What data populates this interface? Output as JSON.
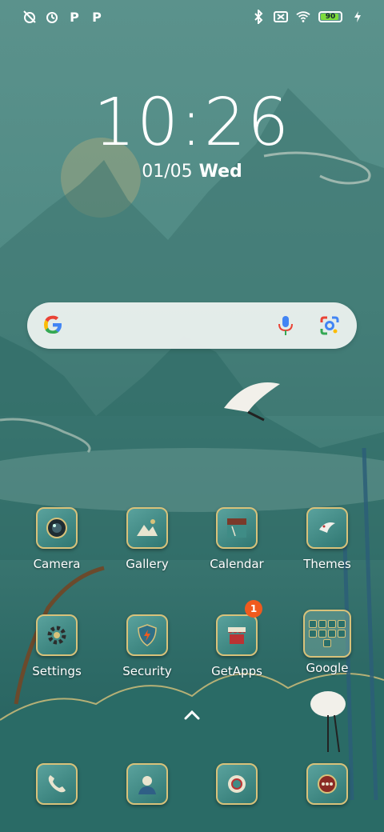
{
  "status_bar": {
    "left_icons": [
      "alarm-off-icon",
      "alarm-clock-icon",
      "p-icon",
      "p-icon"
    ],
    "right_icons": [
      "bluetooth-icon",
      "no-sim-icon",
      "wifi-icon"
    ],
    "battery": {
      "level_percent": 90,
      "label": "90",
      "charging": true
    }
  },
  "clock": {
    "time": "10:26",
    "date": "01/05",
    "weekday": "Wed"
  },
  "search_bar": {
    "logo": "google-g-icon",
    "voice": "mic-icon",
    "lens": "lens-icon"
  },
  "apps": [
    {
      "label": "Camera"
    },
    {
      "label": "Gallery"
    },
    {
      "label": "Calendar"
    },
    {
      "label": "Themes"
    },
    {
      "label": "Settings"
    },
    {
      "label": "Security"
    },
    {
      "label": "GetApps",
      "badge": "1"
    },
    {
      "label": "Google"
    }
  ],
  "dock": [
    "phone-icon",
    "contacts-icon",
    "chrome-icon",
    "messages-icon"
  ],
  "colors": {
    "accent_gold": "#d8c27a",
    "badge": "#f05a1e",
    "battery": "#7ddc3c"
  }
}
